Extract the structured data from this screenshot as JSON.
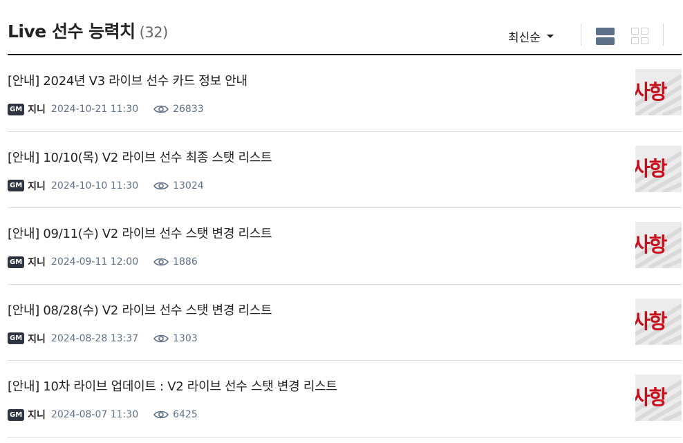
{
  "header": {
    "title": "Live 선수 능력치",
    "count": "(32)",
    "sort_label": "최신순"
  },
  "posts": [
    {
      "title": "[안내] 2024년 V3 라이브 선수 카드 정보 안내",
      "badge": "GM",
      "author": "지니",
      "date": "2024-10-21 11:30",
      "views": "26833",
      "thumb_text": "사항"
    },
    {
      "title": "[안내] 10/10(목) V2 라이브 선수 최종 스탯 리스트",
      "badge": "GM",
      "author": "지니",
      "date": "2024-10-10 11:30",
      "views": "13024",
      "thumb_text": "사항"
    },
    {
      "title": "[안내] 09/11(수) V2 라이브 선수 스탯 변경 리스트",
      "badge": "GM",
      "author": "지니",
      "date": "2024-09-11 12:00",
      "views": "1886",
      "thumb_text": "사항"
    },
    {
      "title": "[안내] 08/28(수) V2 라이브 선수 스탯 변경 리스트",
      "badge": "GM",
      "author": "지니",
      "date": "2024-08-28 13:37",
      "views": "1303",
      "thumb_text": "사항"
    },
    {
      "title": "[안내] 10차 라이브 업데이트 : V2 라이브 선수 스탯 변경 리스트",
      "badge": "GM",
      "author": "지니",
      "date": "2024-08-07 11:30",
      "views": "6425",
      "thumb_text": "사항"
    }
  ],
  "icons": {
    "sort": "caret-down-icon",
    "list_view": "list-view-icon",
    "grid_view": "grid-view-icon",
    "views": "eye-icon"
  },
  "colors": {
    "accent_red": "#c8101d",
    "meta_text": "#5f7189",
    "badge_bg": "#2e3440",
    "list_icon_active": "#5e6f89",
    "grid_icon_inactive": "#c3c9d2"
  }
}
